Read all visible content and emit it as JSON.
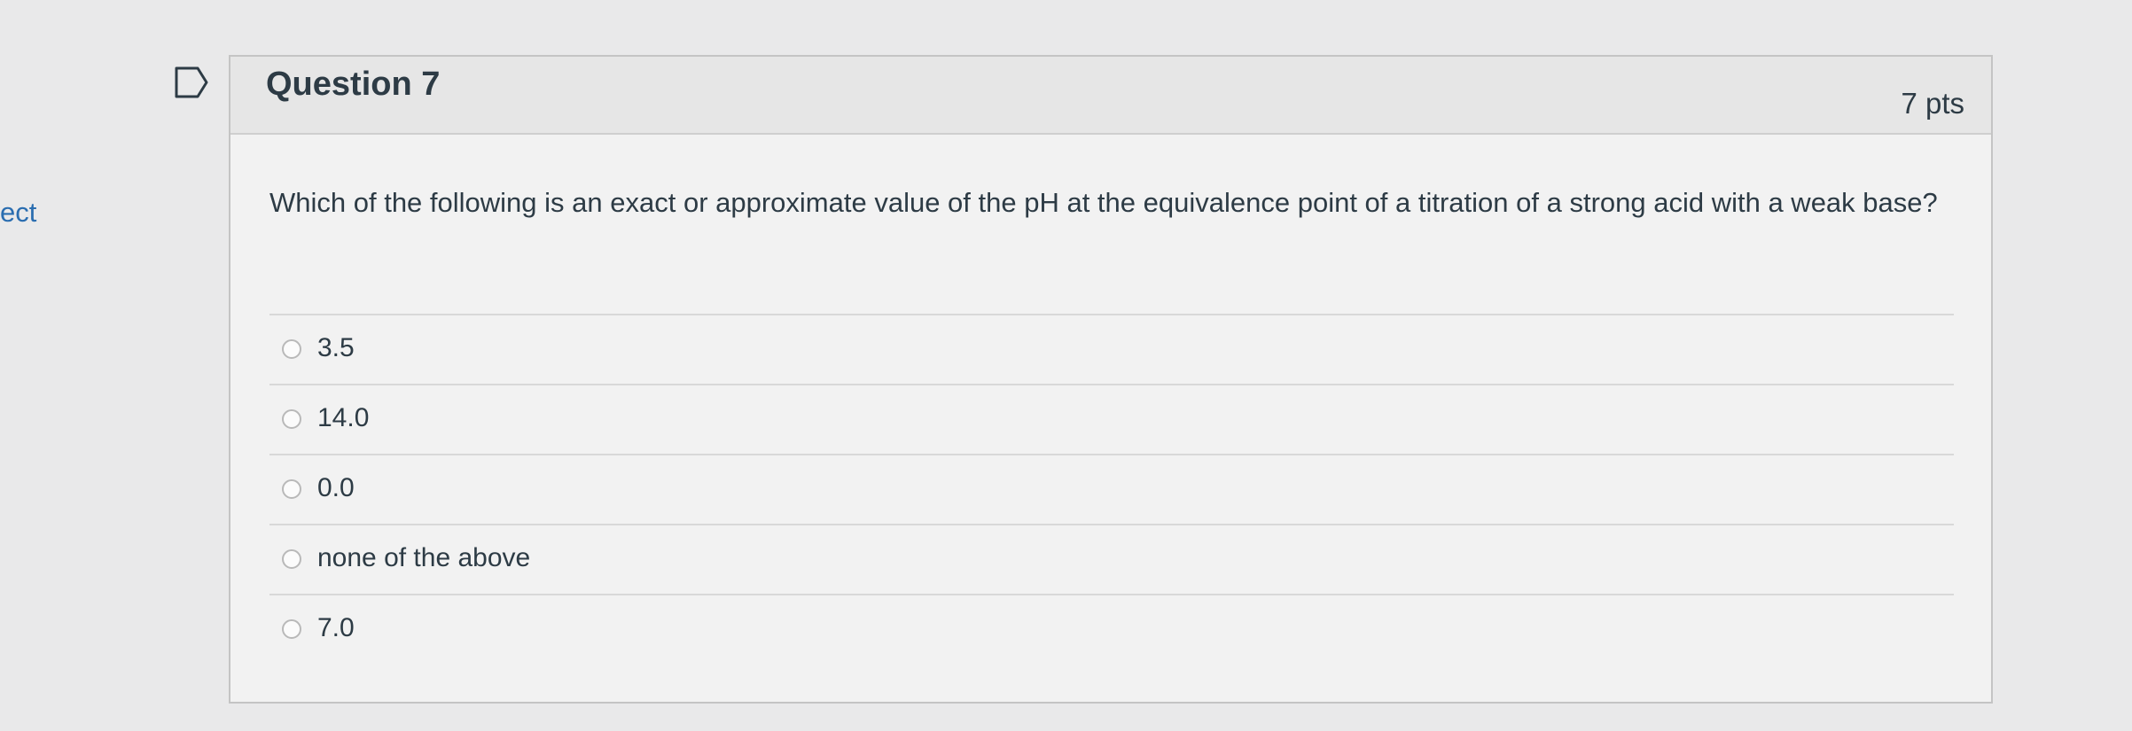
{
  "sidebar": {
    "cut_text": "ect"
  },
  "question": {
    "title": "Question 7",
    "points": "7 pts",
    "text": "Which of the following is an exact or approximate value of the pH at the equivalence point of a titration of a strong acid with a weak base?",
    "answers": [
      {
        "label": "3.5",
        "selected": false
      },
      {
        "label": "14.0",
        "selected": false
      },
      {
        "label": "0.0",
        "selected": false
      },
      {
        "label": "none of the above",
        "selected": false
      },
      {
        "label": "7.0",
        "selected": false
      }
    ]
  },
  "icons": {
    "flag": "flag-icon"
  },
  "colors": {
    "link": "#2a6db0",
    "text": "#2d3b45",
    "border": "#c4c4c4"
  }
}
